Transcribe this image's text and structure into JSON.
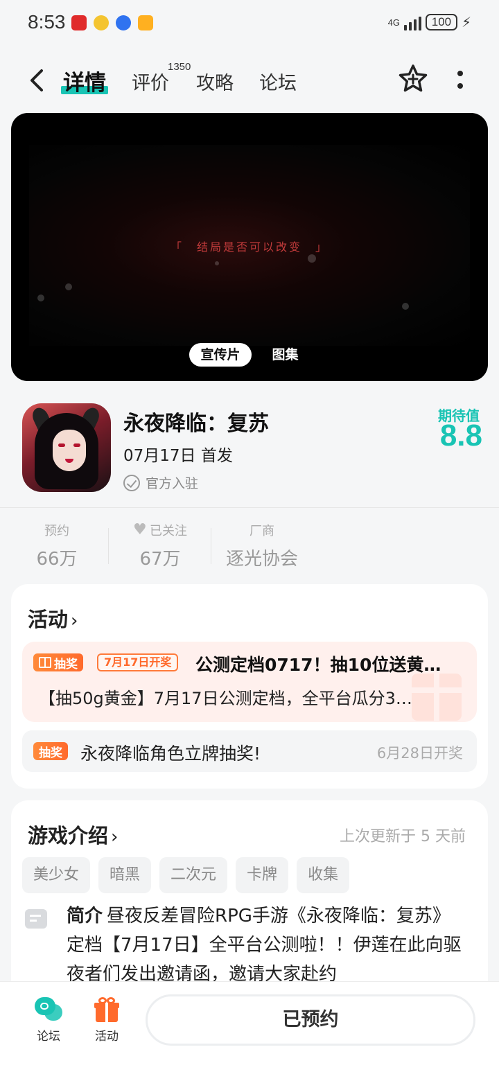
{
  "status_bar": {
    "time": "8:53",
    "network_label": "4G",
    "battery": "100"
  },
  "nav": {
    "tabs": [
      {
        "label": "详情",
        "active": true
      },
      {
        "label": "评价",
        "badge": "1350"
      },
      {
        "label": "攻略"
      },
      {
        "label": "论坛"
      }
    ],
    "accent_color": "#19c4b4"
  },
  "video": {
    "caption": "「　结局是否可以改变　」",
    "tabs": [
      "宣传片",
      "图集"
    ]
  },
  "game": {
    "title": "永夜降临：复苏",
    "release": "07月17日 首发",
    "official": "官方入驻",
    "expect_label": "期待值",
    "expect_score": "8.8"
  },
  "stats": [
    {
      "label": "预约",
      "value": "66万"
    },
    {
      "label": "已关注",
      "value": "67万"
    },
    {
      "label": "厂商",
      "value": "逐光协会"
    }
  ],
  "activities": {
    "title": "活动",
    "items": [
      {
        "badge": "抽奖",
        "date_badge": "7月17日开奖",
        "title": "公测定档0717！抽10位送黄…",
        "desc": "【抽50g黄金】7月17日公测定档，全平台瓜分3…"
      },
      {
        "badge": "抽奖",
        "title": "永夜降临角色立牌抽奖!",
        "date": "6月28日开奖"
      }
    ]
  },
  "intro": {
    "title": "游戏介绍",
    "updated": "上次更新于 5 天前",
    "tags": [
      "美少女",
      "暗黑",
      "二次元",
      "卡牌",
      "收集"
    ],
    "label": "简介",
    "text": "昼夜反差冒险RPG手游《永夜降临：复苏》定档【7月17日】全平台公测啦！！伊莲在此向驱夜者们发出邀请函，邀请大家赴约"
  },
  "bottom_bar": {
    "forum_label": "论坛",
    "activity_label": "活动",
    "reserve_label": "已预约"
  }
}
